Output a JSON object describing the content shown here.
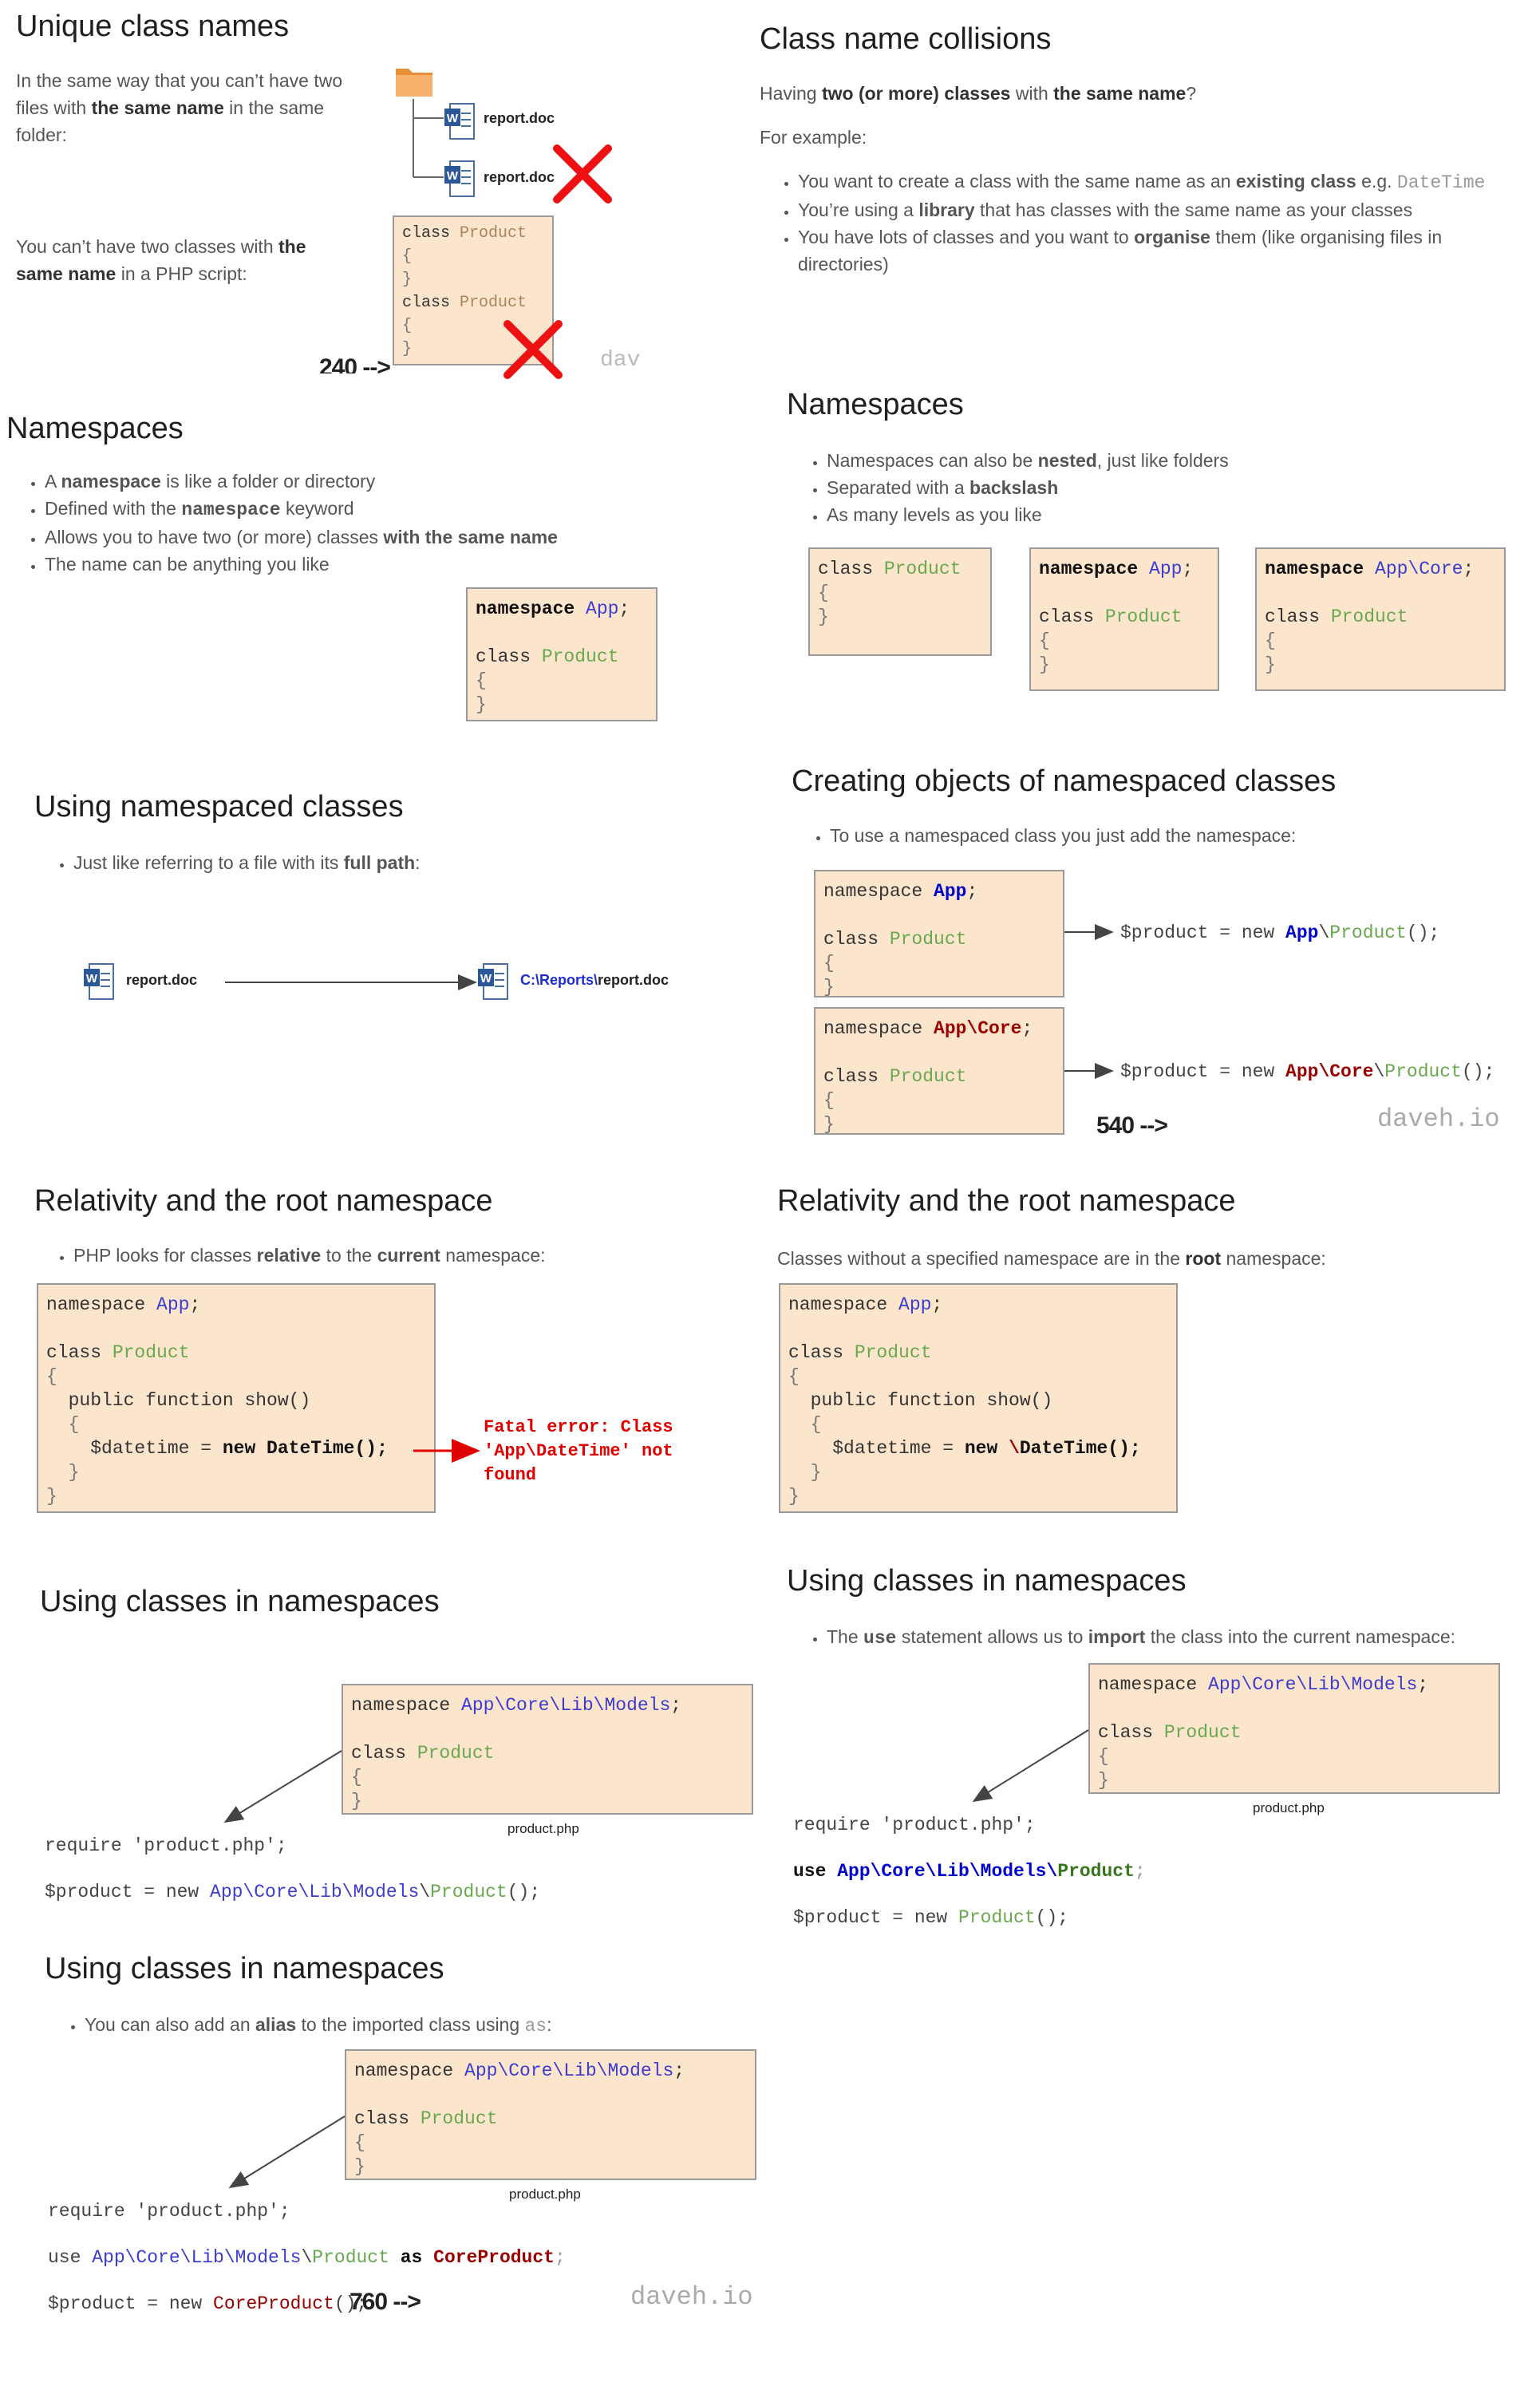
{
  "brand_text": "daveh.io",
  "brand_partial": "dav",
  "counters": [
    "240 -->",
    "540 -->",
    "760 -->"
  ],
  "files": {
    "report": "report.doc",
    "full_path_prefix": "C:\\Reports\\",
    "full_path_file": "report.doc",
    "product_php": "product.php"
  },
  "s1": {
    "title": "Unique class names",
    "p1_a": "In the same way that you can’t have two files with ",
    "p1_b": "the same name",
    "p1_c": " in the same folder:",
    "p2_a": "You can’t have two classes with ",
    "p2_b": "the same name",
    "p2_c": " in a PHP script:"
  },
  "s2": {
    "title": "Class name collisions",
    "intro_a": "Having ",
    "intro_b": "two (or more) classes",
    "intro_c": " with ",
    "intro_d": "the same name",
    "intro_e": "?",
    "example": "For example:",
    "b1_a": "You want to create a class with the same name as an ",
    "b1_b": "existing class",
    "b1_c": " e.g. ",
    "b1_d": "DateTime",
    "b2_a": "You’re using a ",
    "b2_b": "library",
    "b2_c": " that has classes with the same name as your classes",
    "b3_a": "You have lots of classes and you want to ",
    "b3_b": "organise",
    "b3_c": " them (like organising files in directories)"
  },
  "s3": {
    "title": "Namespaces",
    "b1_a": "A ",
    "b1_b": "namespace",
    "b1_c": " is like a folder or directory",
    "b2_a": "Defined with the ",
    "b2_b": "namespace",
    "b2_c": " keyword",
    "b3_a": "Allows you to have two (or more) classes ",
    "b3_b": "with the same name",
    "b4": "The name can be anything you like"
  },
  "s4": {
    "title": "Namespaces",
    "b1_a": "Namespaces can also be ",
    "b1_b": "nested",
    "b1_c": ", just like folders",
    "b2_a": "Separated with a ",
    "b2_b": "backslash",
    "b3": "As many levels as you like"
  },
  "s5": {
    "title": "Using namespaced classes",
    "b1_a": "Just like referring to a file with its ",
    "b1_b": "full path",
    "b1_c": ":"
  },
  "s6": {
    "title": "Creating objects of namespaced classes",
    "b1": "To use a namespaced class you just add the namespace:"
  },
  "s7": {
    "title": "Relativity and the root namespace",
    "b1_a": "PHP looks for classes ",
    "b1_b": "relative",
    "b1_c": " to the ",
    "b1_d": "current",
    "b1_e": " namespace:",
    "error": "Fatal error: Class\n'App\\DateTime' not\nfound"
  },
  "s8": {
    "title": "Relativity and the root namespace",
    "p_a": "Classes without a specified namespace are in the ",
    "p_b": "root",
    "p_c": " namespace:"
  },
  "s9": {
    "title": "Using classes in namespaces"
  },
  "s10": {
    "title": "Using classes in namespaces",
    "b1_a": "The ",
    "b1_b": "use",
    "b1_c": " statement allows us to ",
    "b1_d": "import",
    "b1_e": " the class into the current namespace:"
  },
  "s11": {
    "title": "Using classes in namespaces",
    "b1_a": "You can also add an ",
    "b1_b": "alias",
    "b1_c": " to the imported class using ",
    "b1_d": "as",
    "b1_e": ":"
  }
}
